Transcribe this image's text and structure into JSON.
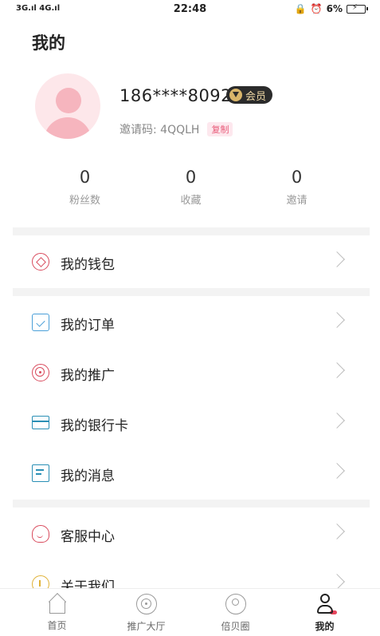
{
  "status_bar": {
    "signal": "3G.ıl 4G.ıl",
    "time": "22:48",
    "battery_pct": "6%"
  },
  "page": {
    "title": "我的"
  },
  "profile": {
    "phone": "186****8092",
    "vip_label": "会员",
    "invite_prefix": "邀请码: 4QQLH",
    "copy_label": "复制"
  },
  "stats": [
    {
      "value": "0",
      "label": "粉丝数"
    },
    {
      "value": "0",
      "label": "收藏"
    },
    {
      "value": "0",
      "label": "邀请"
    }
  ],
  "menu": [
    {
      "label": "我的钱包",
      "icon": "wallet-icon"
    },
    {
      "label": "我的订单",
      "icon": "order-icon"
    },
    {
      "label": "我的推广",
      "icon": "promotion-icon"
    },
    {
      "label": "我的银行卡",
      "icon": "bank-card-icon"
    },
    {
      "label": "我的消息",
      "icon": "message-icon"
    },
    {
      "label": "客服中心",
      "icon": "customer-service-icon"
    },
    {
      "label": "关于我们",
      "icon": "about-icon"
    }
  ],
  "tabs": [
    {
      "label": "首页",
      "icon": "home-icon"
    },
    {
      "label": "推广大厅",
      "icon": "promotion-hall-icon"
    },
    {
      "label": "倍贝圈",
      "icon": "circle-icon"
    },
    {
      "label": "我的",
      "icon": "user-icon",
      "active": true
    }
  ],
  "colors": {
    "accent": "#e8455d",
    "badge_bg": "#2b2b2b",
    "badge_text": "#f0d9a6"
  }
}
